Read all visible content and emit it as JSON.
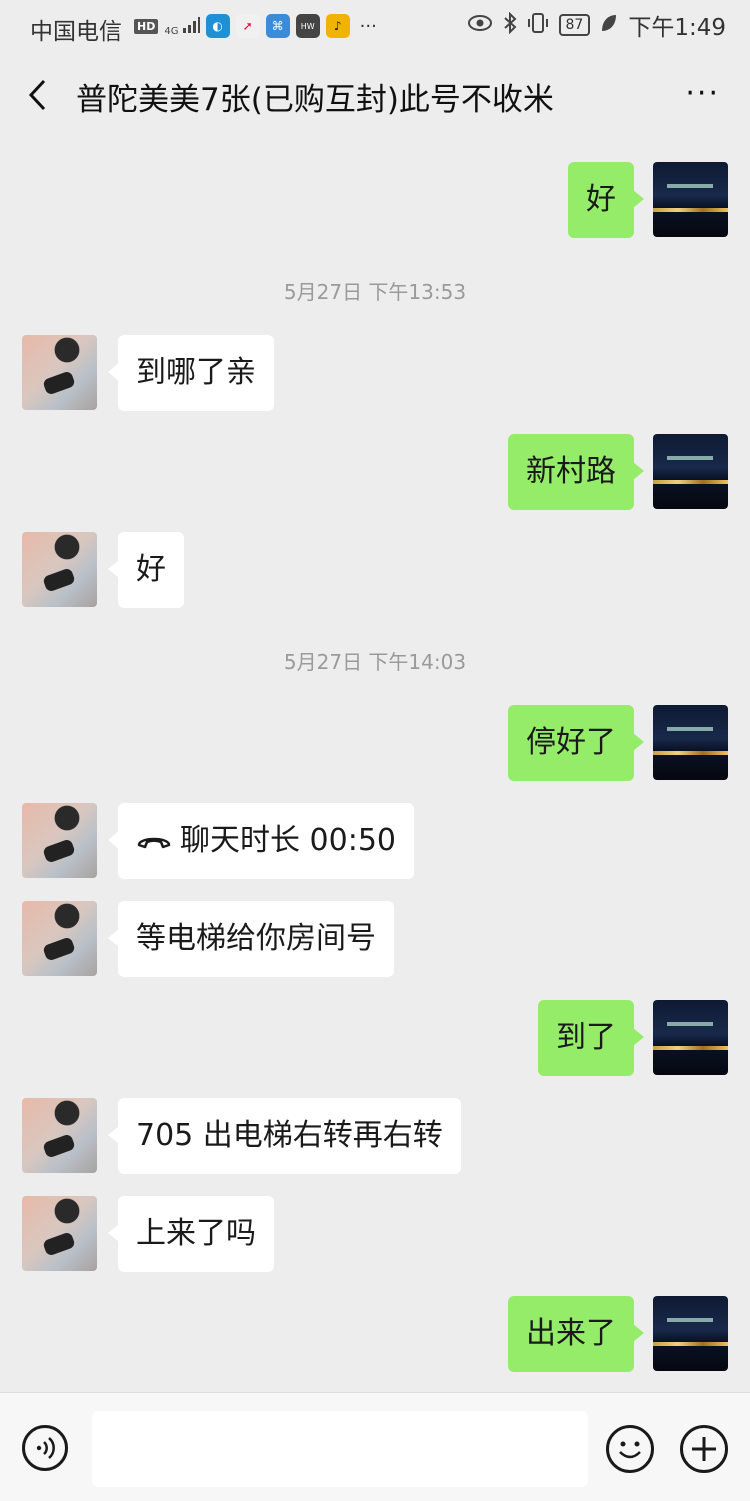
{
  "status_bar": {
    "carrier": "中国电信",
    "hd": "HD",
    "net_type": "4G",
    "battery": "87",
    "time": "下午1:49",
    "icons": [
      "hd-icon",
      "signal-icon",
      "app-icon-1",
      "compass-icon",
      "app-icon-2",
      "huawei-icon",
      "app-icon-3",
      "more-dots-icon",
      "eye-icon",
      "bluetooth-icon",
      "vibrate-icon",
      "battery-icon",
      "leaf-icon"
    ]
  },
  "header": {
    "title": "普陀美美7张(已购互封)此号不收米",
    "more": "···"
  },
  "messages": [
    {
      "side": "right",
      "text": "好"
    },
    {
      "type": "time",
      "text": "5月27日 下午13:53"
    },
    {
      "side": "left",
      "text": "到哪了亲"
    },
    {
      "side": "right",
      "text": "新村路"
    },
    {
      "side": "left",
      "text": "好"
    },
    {
      "type": "time",
      "text": "5月27日 下午14:03"
    },
    {
      "side": "right",
      "text": "停好了"
    },
    {
      "side": "left",
      "text": "聊天时长 00:50",
      "icon": "phone-hangup-icon"
    },
    {
      "side": "left",
      "text": "等电梯给你房间号"
    },
    {
      "side": "right",
      "text": "到了"
    },
    {
      "side": "left",
      "text": "705 出电梯右转再右转"
    },
    {
      "side": "left",
      "text": "上来了吗"
    },
    {
      "side": "right",
      "text": "出来了"
    }
  ],
  "input_bar": {
    "placeholder": ""
  }
}
